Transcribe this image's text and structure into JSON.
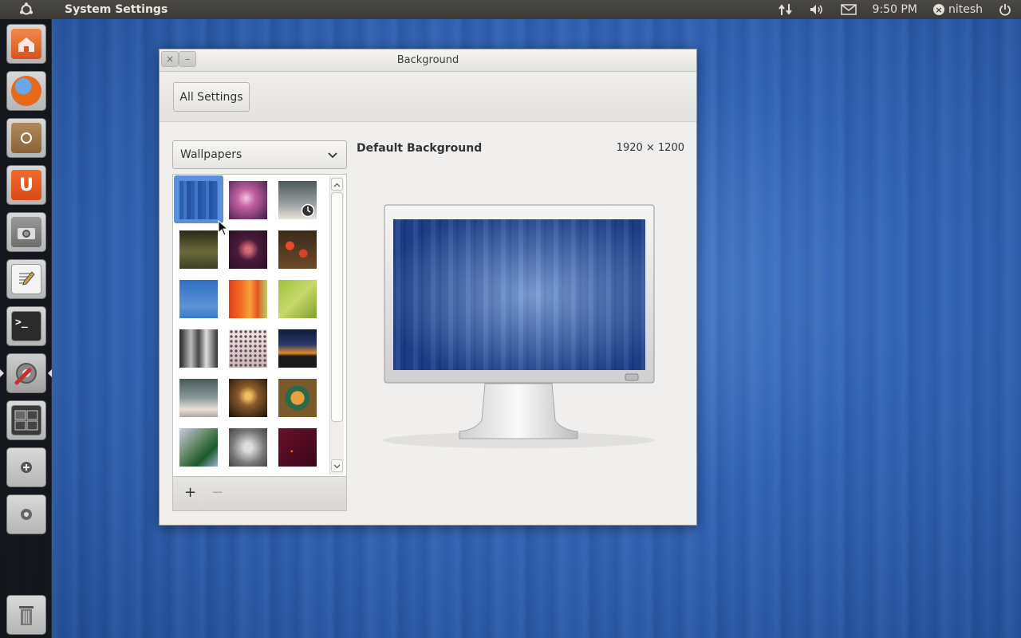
{
  "panel": {
    "app_title": "System Settings",
    "time": "9:50 PM",
    "user": "nitesh",
    "icons": [
      "ubuntu-logo-icon",
      "network-arrows-icon",
      "volume-icon",
      "mail-icon",
      "user-status-icon",
      "power-icon"
    ]
  },
  "launcher": {
    "items": [
      {
        "name": "home-folder",
        "icon": "folder-home-icon"
      },
      {
        "name": "firefox",
        "icon": "firefox-icon"
      },
      {
        "name": "software-center",
        "icon": "software-center-icon"
      },
      {
        "name": "ubuntu-one",
        "icon": "ubuntu-one-icon"
      },
      {
        "name": "shotwell",
        "icon": "camera-icon"
      },
      {
        "name": "text-editor",
        "icon": "text-editor-icon"
      },
      {
        "name": "terminal",
        "icon": "terminal-icon"
      },
      {
        "name": "system-settings",
        "icon": "settings-tools-icon"
      },
      {
        "name": "workspaces",
        "icon": "workspace-switcher-icon"
      },
      {
        "name": "removable-drive-1",
        "icon": "drive-icon"
      },
      {
        "name": "removable-drive-2",
        "icon": "optical-drive-icon"
      },
      {
        "name": "trash",
        "icon": "trash-icon"
      }
    ]
  },
  "window": {
    "title": "Background",
    "close_label": "×",
    "minimize_label": "–",
    "all_settings_label": "All Settings",
    "source_combo": {
      "selected": "Wallpapers"
    },
    "add_label": "+",
    "remove_label": "−",
    "background_name": "Default Background",
    "background_size": "1920 × 1200",
    "selected_index": 0
  },
  "colors": {
    "accent": "#5b8fd9",
    "panel": "#3c3b37",
    "launcher": "#121212",
    "desktop": "#2f62b4"
  }
}
